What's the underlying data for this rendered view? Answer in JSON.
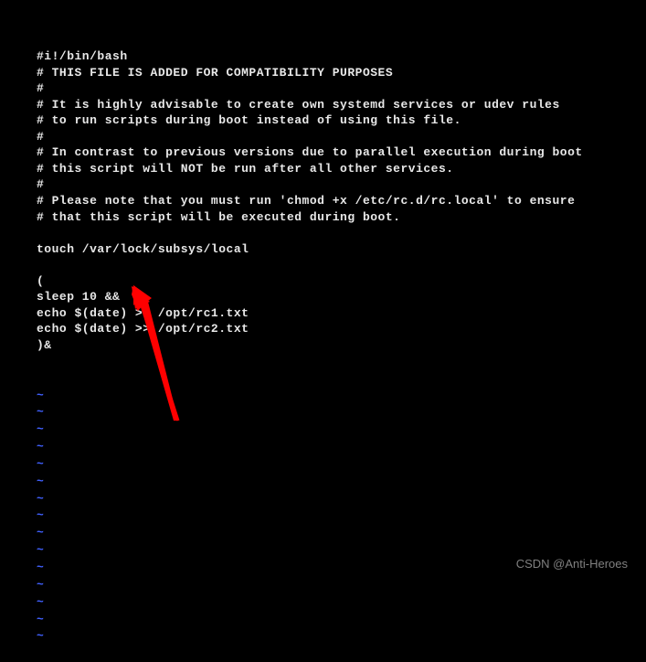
{
  "terminal": {
    "lines": [
      "#i!/bin/bash",
      "# THIS FILE IS ADDED FOR COMPATIBILITY PURPOSES",
      "#",
      "# It is highly advisable to create own systemd services or udev rules",
      "# to run scripts during boot instead of using this file.",
      "#",
      "# In contrast to previous versions due to parallel execution during boot",
      "# this script will NOT be run after all other services.",
      "#",
      "# Please note that you must run 'chmod +x /etc/rc.d/rc.local' to ensure",
      "# that this script will be executed during boot.",
      "",
      "touch /var/lock/subsys/local",
      "",
      "(",
      "sleep 10 &&",
      "echo $(date) >> /opt/rc1.txt",
      "echo $(date) >> /opt/rc2.txt",
      ")&"
    ],
    "tilde_count": 15,
    "tilde_char": "~"
  },
  "watermark": "CSDN @Anti-Heroes"
}
